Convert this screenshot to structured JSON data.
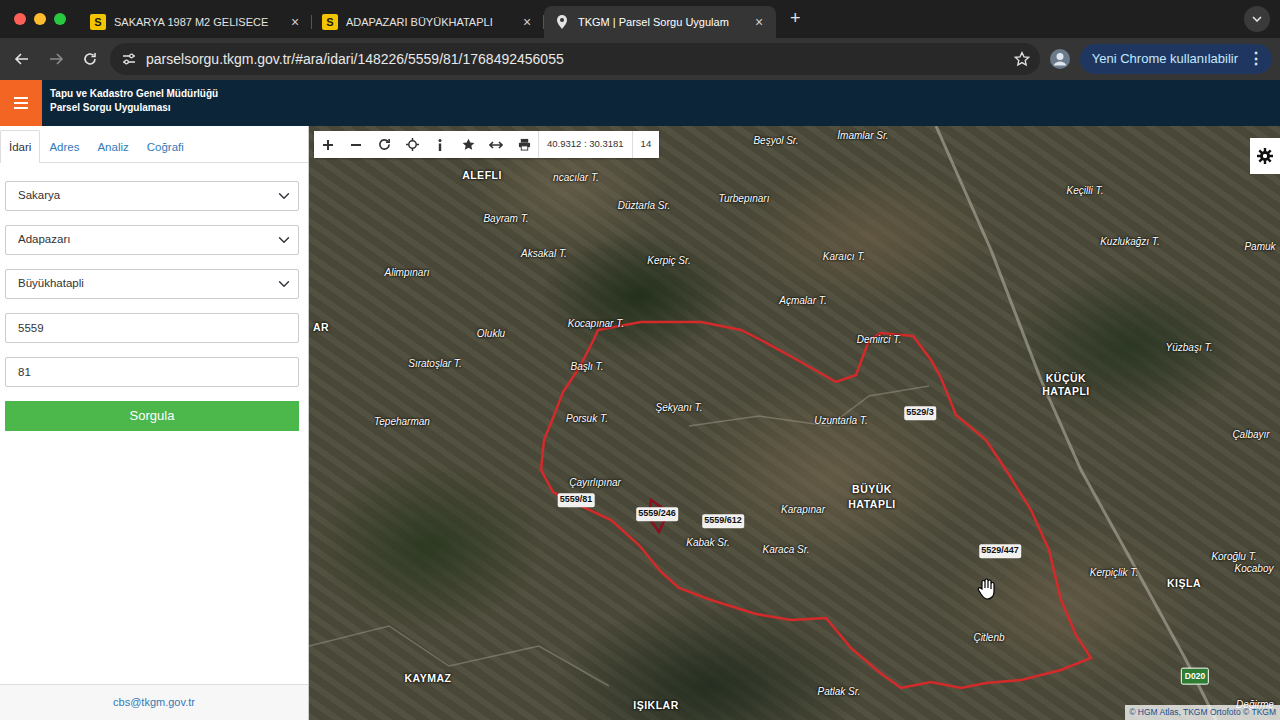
{
  "browser": {
    "tabs": [
      {
        "favicon": "S",
        "label": "SAKARYA 1987 M2 GELISECE",
        "close": "×",
        "selected": false
      },
      {
        "favicon": "S",
        "label": "ADAPAZARI BÜYÜKHATAPLI",
        "close": "×",
        "selected": false
      },
      {
        "label": "TKGM | Parsel Sorgu Uygulam",
        "close": "×",
        "selected": true
      }
    ],
    "new_tab": "+",
    "url": "parselsorgu.tkgm.gov.tr/#ara/idari/148226/5559/81/1768492456055",
    "update_button": "Yeni Chrome kullanılabilir",
    "menu": "⋮"
  },
  "app": {
    "title": "Tapu ve Kadastro Genel Müdürlüğü",
    "subtitle": "Parsel Sorgu Uygulaması"
  },
  "sidebar": {
    "tabs": [
      {
        "label": "İdari",
        "selected": true
      },
      {
        "label": "Adres",
        "selected": false
      },
      {
        "label": "Analiz",
        "selected": false
      },
      {
        "label": "Coğrafi",
        "selected": false
      }
    ],
    "selects": [
      {
        "value": "Sakarya"
      },
      {
        "value": "Adapazarı"
      },
      {
        "value": "Büyükhatapli"
      }
    ],
    "inputs": [
      {
        "value": "5559"
      },
      {
        "value": "81"
      }
    ],
    "button": "Sorgula",
    "footer": "cbs@tkgm.gov.tr"
  },
  "map": {
    "toolbar": {
      "coordinates": "40.9312 : 30.3181",
      "zoom": "14"
    },
    "places": [
      {
        "text": "ALEFLI",
        "kind": "village"
      },
      {
        "text": "ncacılar T.",
        "kind": "locality"
      },
      {
        "text": "Düztarla Sr.",
        "kind": "locality"
      },
      {
        "text": "Turbepınarı",
        "kind": "locality"
      },
      {
        "text": "Beşyol Sr.",
        "kind": "locality"
      },
      {
        "text": "İmamlar Sr.",
        "kind": "locality"
      },
      {
        "text": "Bayram T.",
        "kind": "locality"
      },
      {
        "text": "Aksakal T.",
        "kind": "locality"
      },
      {
        "text": "Kerpiç Sr.",
        "kind": "locality"
      },
      {
        "text": "Karaıcı T.",
        "kind": "locality"
      },
      {
        "text": "Alimpınarı",
        "kind": "locality"
      },
      {
        "text": "Açmalar T.",
        "kind": "locality"
      },
      {
        "text": "Oluklu",
        "kind": "locality"
      },
      {
        "text": "Kocapınar T.",
        "kind": "locality"
      },
      {
        "text": "Sıratoşlar T.",
        "kind": "locality"
      },
      {
        "text": "Başlı T.",
        "kind": "locality"
      },
      {
        "text": "Demirci T.",
        "kind": "locality"
      },
      {
        "text": "Tepeharman",
        "kind": "locality"
      },
      {
        "text": "Porsuk T.",
        "kind": "locality"
      },
      {
        "text": "Şekyanı T.",
        "kind": "locality"
      },
      {
        "text": "Uzuntarla T.",
        "kind": "locality"
      },
      {
        "text": "Çayırlıpınar",
        "kind": "locality"
      },
      {
        "text": "BÜYÜK",
        "kind": "village"
      },
      {
        "text": "HATAPLI",
        "kind": "village"
      },
      {
        "text": "Kabak Sr.",
        "kind": "locality"
      },
      {
        "text": "Karapınar",
        "kind": "locality"
      },
      {
        "text": "Karaca Sr.",
        "kind": "locality"
      },
      {
        "text": "Çitlenb",
        "kind": "locality"
      },
      {
        "text": "Patlak Sr.",
        "kind": "locality"
      },
      {
        "text": "KAYMAZ",
        "kind": "village"
      },
      {
        "text": "IŞIKLAR",
        "kind": "village"
      },
      {
        "text": "KÜÇÜK",
        "kind": "village"
      },
      {
        "text": "HATAPLI",
        "kind": "village"
      },
      {
        "text": "Keçilli T.",
        "kind": "locality"
      },
      {
        "text": "Kuzlukağzı T.",
        "kind": "locality"
      },
      {
        "text": "Yüzbaşı T.",
        "kind": "locality"
      },
      {
        "text": "Çalbayır",
        "kind": "locality"
      },
      {
        "text": "Kerpiçlik T.",
        "kind": "locality"
      },
      {
        "text": "KIŞLA",
        "kind": "village"
      },
      {
        "text": "Koroğlu T.",
        "kind": "locality"
      },
      {
        "text": "Kocaboy",
        "kind": "locality"
      },
      {
        "text": "Pamuk",
        "kind": "locality"
      },
      {
        "text": "Değirme",
        "kind": "locality"
      },
      {
        "text": "AR",
        "kind": "village"
      }
    ],
    "parcels": [
      {
        "text": "5559/81"
      },
      {
        "text": "5559/246"
      },
      {
        "text": "5559/612"
      },
      {
        "text": "5529/3"
      },
      {
        "text": "5529/447"
      }
    ],
    "road": "D020",
    "attribution": "© HGM Atlas, TKGM Ortofoto © TKGM"
  }
}
